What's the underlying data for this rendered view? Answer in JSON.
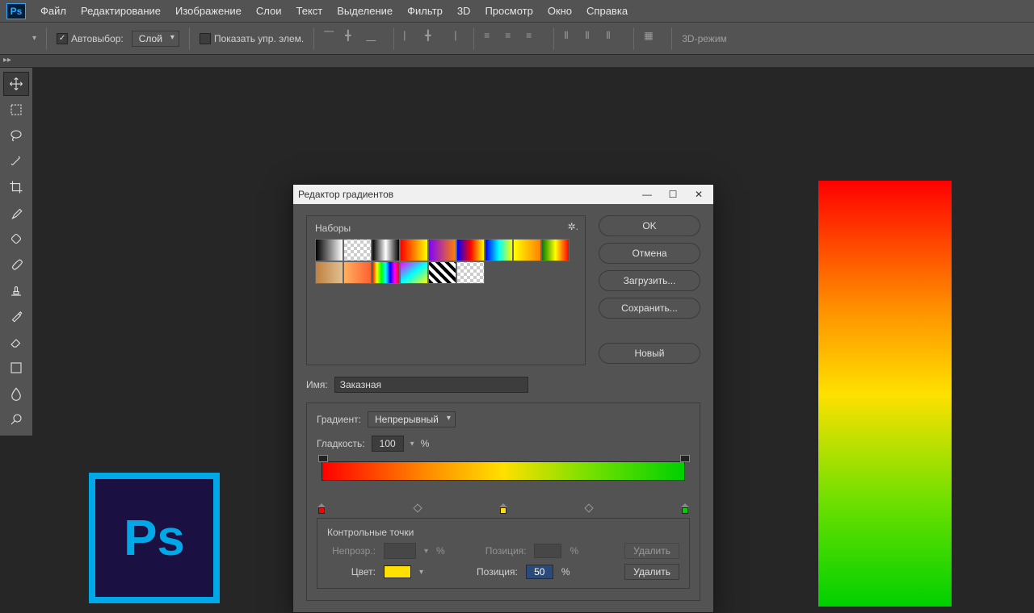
{
  "menu": {
    "file": "Файл",
    "edit": "Редактирование",
    "image": "Изображение",
    "layers": "Слои",
    "text": "Текст",
    "select": "Выделение",
    "filter": "Фильтр",
    "threeD": "3D",
    "view": "Просмотр",
    "window": "Окно",
    "help": "Справка"
  },
  "options": {
    "autoselect": "Автовыбор:",
    "layer": "Слой",
    "show_controls": "Показать упр. элем.",
    "mode3d": "3D-режим"
  },
  "dialog": {
    "title": "Редактор градиентов",
    "presets_label": "Наборы",
    "name_label": "Имя:",
    "name_value": "Заказная",
    "grad_type_label": "Градиент:",
    "grad_type_value": "Непрерывный",
    "smooth_label": "Гладкость:",
    "smooth_value": "100",
    "pct": "%",
    "ctrl_header": "Контрольные точки",
    "opacity_label": "Непрозр.:",
    "position_label": "Позиция:",
    "position_label2": "Позиция:",
    "position_value": "50",
    "color_label": "Цвет:",
    "color_value": "#ffe000",
    "delete": "Удалить",
    "delete2": "Удалить",
    "btns": {
      "ok": "OK",
      "cancel": "Отмена",
      "load": "Загрузить...",
      "save": "Сохранить...",
      "new": "Новый"
    },
    "presets": [
      "linear-gradient(to right,#000,#fff)",
      "repeating-conic-gradient(#ccc 0 25%,#fff 0 50%) 0/8px 8px",
      "linear-gradient(to right,#000,#fff,#000)",
      "linear-gradient(to right,#ff0000,#ffff00)",
      "linear-gradient(to right,#8000ff,#ff8000)",
      "linear-gradient(to right,#0000ff,#ff0000,#ffff00)",
      "linear-gradient(to right,#0000ff,#00ffff,#ffff00)",
      "linear-gradient(to right,#ffff00,#ff8000)",
      "linear-gradient(to right,#008000,#ffff00,#ff0000)",
      "linear-gradient(to right,#c08040,#e0c090)",
      "linear-gradient(to right,#ffb060,#ff6030)",
      "linear-gradient(to right,#ff0000,#ffff00,#00ff00,#00ffff,#0000ff,#ff00ff,#ff0000)",
      "linear-gradient(to bottom right,#ff00ff,#00ffff,#ffff00)",
      "repeating-linear-gradient(45deg,#000 0 4px,#fff 4px 8px)",
      "repeating-conic-gradient(#ccc 0 25%,#fff 0 50%) 0/8px 8px"
    ],
    "gradient_stops": [
      {
        "pos": 0,
        "color": "#ff0000"
      },
      {
        "pos": 50,
        "color": "#ffe000"
      },
      {
        "pos": 100,
        "color": "#00d000"
      }
    ],
    "midpoints": [
      27,
      73
    ]
  },
  "ps_badge": "Ps"
}
